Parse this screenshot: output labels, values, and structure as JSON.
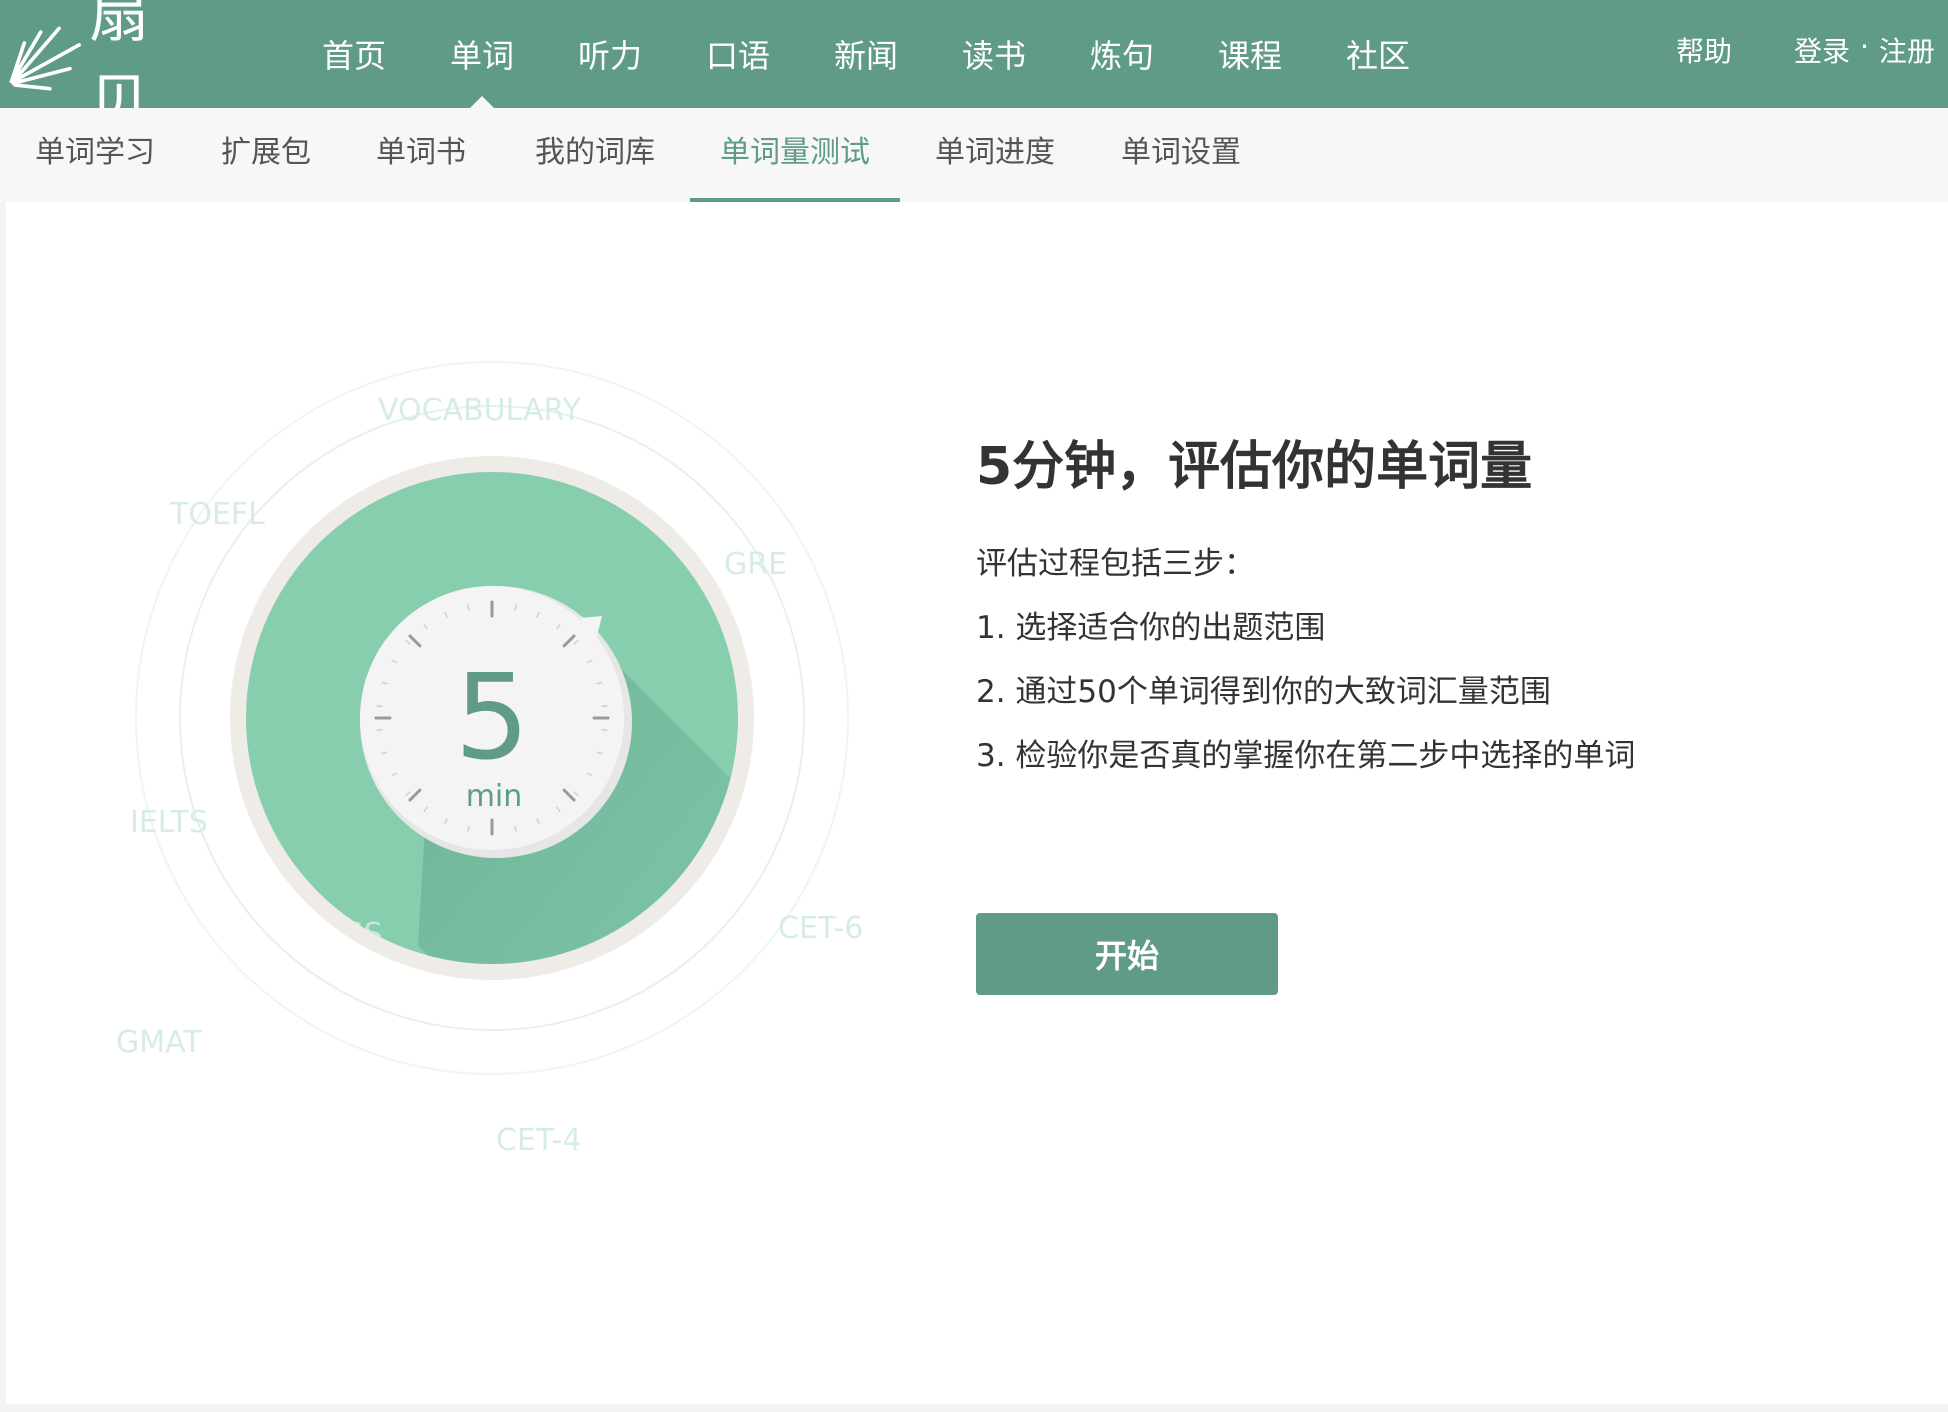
{
  "brand": {
    "name": "扇贝",
    "logo_icon": "fan-shell-logo-icon"
  },
  "main_nav": {
    "items": [
      {
        "label": "首页"
      },
      {
        "label": "单词"
      },
      {
        "label": "听力"
      },
      {
        "label": "口语"
      },
      {
        "label": "新闻"
      },
      {
        "label": "读书"
      },
      {
        "label": "炼句"
      },
      {
        "label": "课程"
      },
      {
        "label": "社区"
      }
    ],
    "active": "单词",
    "help": "帮助",
    "login": "登录",
    "separator": "·",
    "register": "注册"
  },
  "sub_nav": {
    "items": [
      {
        "label": "单词学习"
      },
      {
        "label": "扩展包"
      },
      {
        "label": "单词书"
      },
      {
        "label": "我的词库"
      },
      {
        "label": "单词量测试"
      },
      {
        "label": "单词进度"
      },
      {
        "label": "单词设置"
      }
    ],
    "active": "单词量测试"
  },
  "dial": {
    "number": "5",
    "unit": "min",
    "exam_labels": [
      "VOCABULARY",
      "TOEFL",
      "GRE",
      "IELTS",
      "KISS",
      "CET-6",
      "GMAT",
      "CET-4"
    ]
  },
  "panel": {
    "title": "5分钟，评估你的单词量",
    "intro": "评估过程包括三步：",
    "steps": [
      "1. 选择适合你的出题范围",
      "2. 通过50个单词得到你的大致词汇量范围",
      "3. 检验你是否真的掌握你在第二步中选择的单词"
    ],
    "start_label": "开始"
  },
  "colors": {
    "brand_green": "#5f9b88",
    "dial_green": "#86ceae",
    "faint_label": "#d6ece4"
  }
}
